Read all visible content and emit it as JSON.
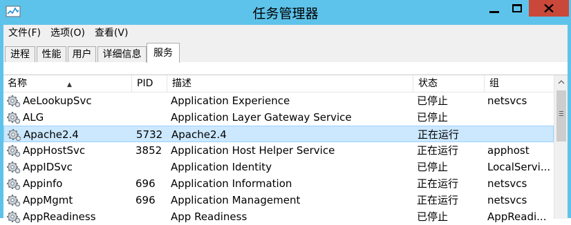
{
  "window": {
    "title": "任务管理器",
    "icons": {
      "app": "task-manager-icon",
      "minimize": "minimize-icon",
      "maximize": "maximize-icon",
      "close": "close-icon"
    },
    "colors": {
      "titlebar": "#5ec3ea",
      "close": "#c9483a",
      "selection": "#cce8ff"
    }
  },
  "menu": {
    "file": "文件(F)",
    "options": "选项(O)",
    "view": "查看(V)"
  },
  "tabs": {
    "processes": "进程",
    "performance": "性能",
    "users": "用户",
    "details": "详细信息",
    "services": "服务",
    "active": "服务"
  },
  "table": {
    "columns": {
      "name": "名称",
      "pid": "PID",
      "description": "描述",
      "status": "状态",
      "group": "组"
    },
    "sort": {
      "column": "名称",
      "direction": "ascending"
    },
    "rows": [
      {
        "name": "AeLookupSvc",
        "pid": "",
        "description": "Application Experience",
        "status": "已停止",
        "group": "netsvcs"
      },
      {
        "name": "ALG",
        "pid": "",
        "description": "Application Layer Gateway Service",
        "status": "已停止",
        "group": ""
      },
      {
        "name": "Apache2.4",
        "pid": "5732",
        "description": "Apache2.4",
        "status": "正在运行",
        "group": ""
      },
      {
        "name": "AppHostSvc",
        "pid": "3852",
        "description": "Application Host Helper Service",
        "status": "正在运行",
        "group": "apphost"
      },
      {
        "name": "AppIDSvc",
        "pid": "",
        "description": "Application Identity",
        "status": "已停止",
        "group": "LocalServi..."
      },
      {
        "name": "Appinfo",
        "pid": "696",
        "description": "Application Information",
        "status": "正在运行",
        "group": "netsvcs"
      },
      {
        "name": "AppMgmt",
        "pid": "696",
        "description": "Application Management",
        "status": "正在运行",
        "group": "netsvcs"
      },
      {
        "name": "AppReadiness",
        "pid": "",
        "description": "App Readiness",
        "status": "已停止",
        "group": "AppReadi..."
      }
    ],
    "selected_row": "Apache2.4"
  }
}
